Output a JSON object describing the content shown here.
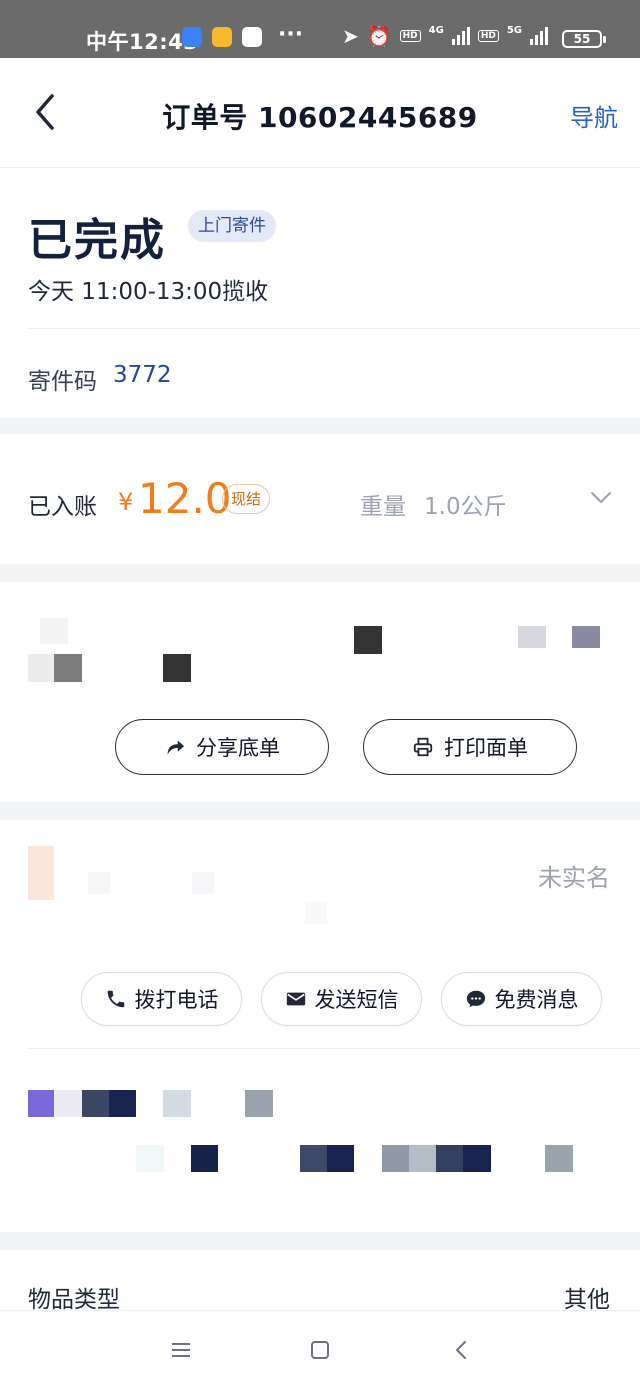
{
  "status_bar": {
    "time": "中午12:43",
    "more": "···",
    "net1": "4G",
    "net2": "5G",
    "hd": "HD",
    "battery": "55"
  },
  "header": {
    "title": "订单号 10602445689",
    "nav_label": "导航"
  },
  "order_status": {
    "title": "已完成",
    "badge": "上门寄件",
    "pickup_time": "今天 11:00-13:00揽收",
    "code_label": "寄件码",
    "code_value": "3772"
  },
  "payment": {
    "label": "已入账",
    "currency": "¥",
    "amount": "12.0",
    "tag": "现结",
    "weight_label": "重量",
    "weight_value": "1.0公斤"
  },
  "sender_actions": {
    "share_label": "分享底单",
    "print_label": "打印面单"
  },
  "receiver": {
    "realname_status": "未实名",
    "call_label": "拨打电话",
    "sms_label": "发送短信",
    "message_label": "免费消息"
  },
  "goods": {
    "label": "物品类型",
    "value": "其他"
  },
  "colors": {
    "accent_blue": "#2563c9",
    "amount_orange": "#f07d1a",
    "status_dark": "#14213d"
  }
}
